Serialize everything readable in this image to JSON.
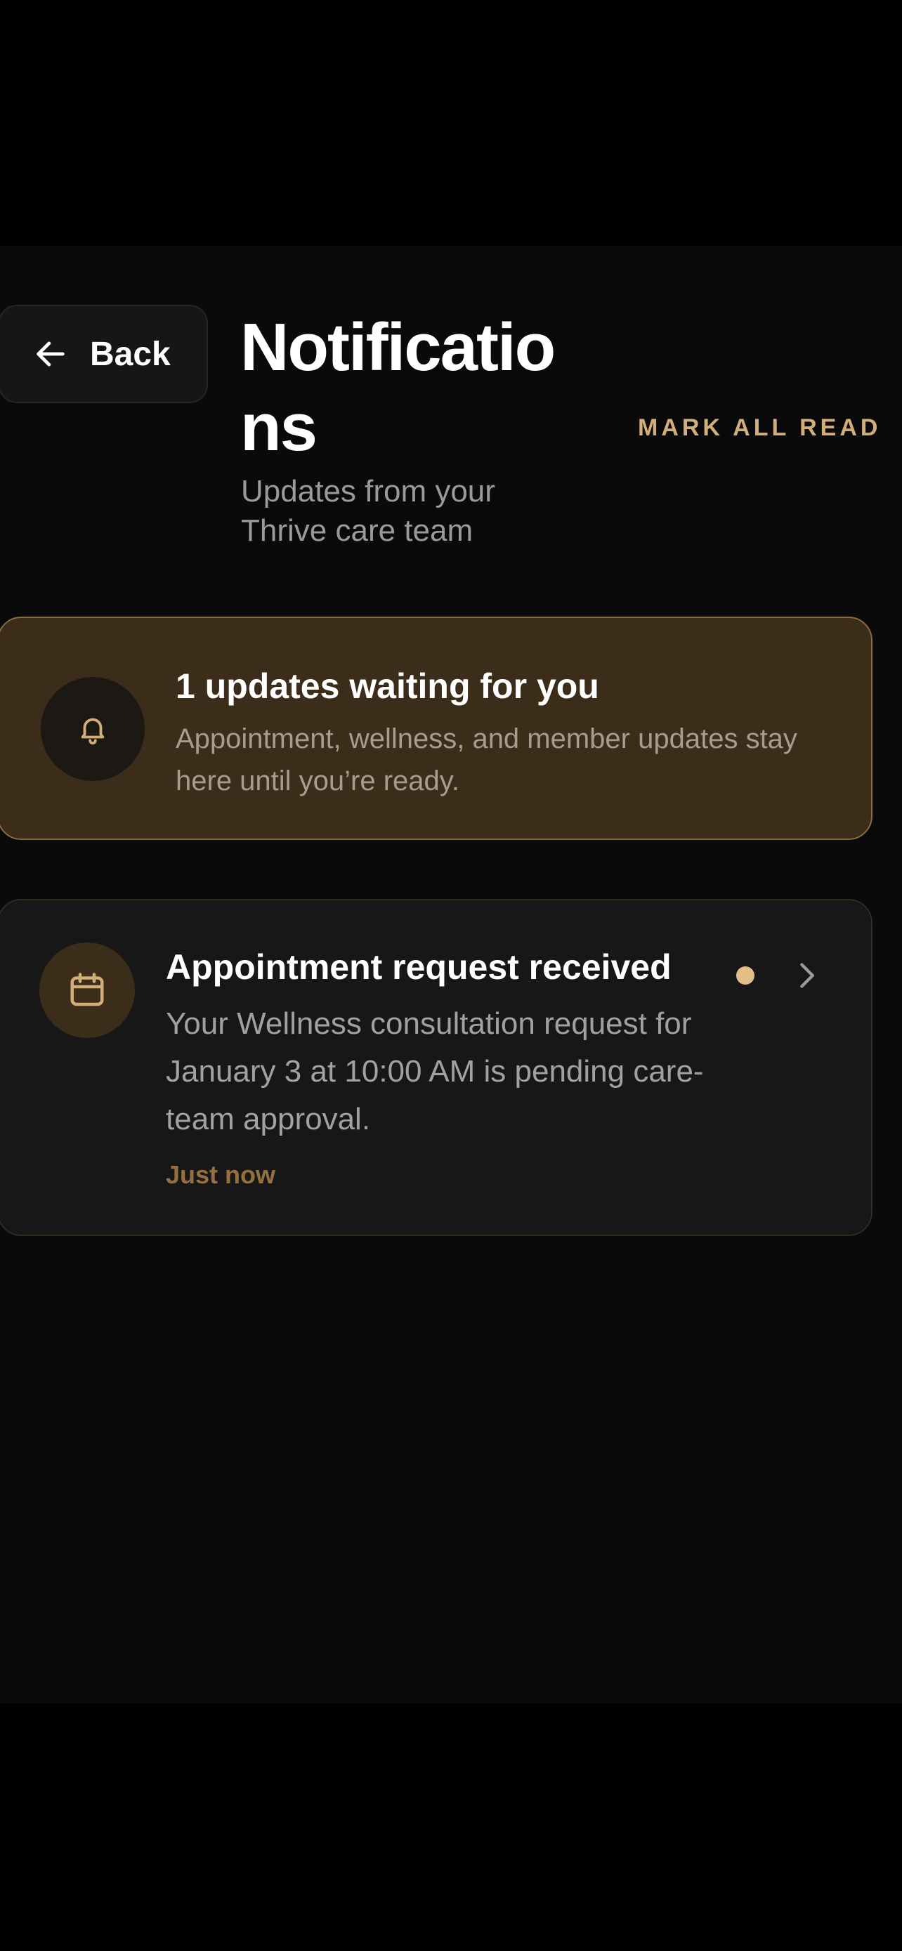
{
  "header": {
    "back_label": "Back",
    "title": "Notifications",
    "subtitle": "Updates from your Thrive care team",
    "mark_all_label": "MARK ALL READ"
  },
  "summary": {
    "title": "1 updates waiting for you",
    "description": "Appointment, wellness, and member updates stay here until you’re ready.",
    "icon": "bell-icon"
  },
  "notifications": [
    {
      "title": "Appointment request received",
      "body": "Your Wellness consultation request for January 3 at 10:00 AM is pending care-team approval.",
      "time": "Just now",
      "unread": true,
      "icon": "calendar-icon"
    }
  ],
  "colors": {
    "accent": "#d2ae79",
    "summary_bg": "#3c2c1a",
    "card_bg": "#171717",
    "screen_bg": "#0a0a0a"
  }
}
